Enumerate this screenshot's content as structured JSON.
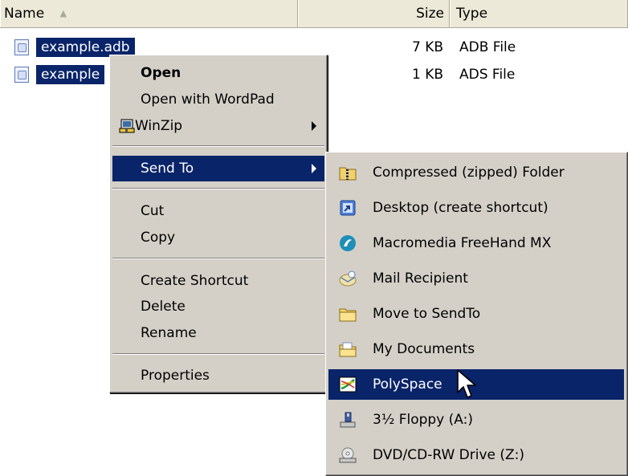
{
  "columns": {
    "name": "Name",
    "size": "Size",
    "type": "Type"
  },
  "files": [
    {
      "name": "example.adb",
      "size": "7 KB",
      "type": "ADB File"
    },
    {
      "name": "example",
      "size": "1 KB",
      "type": "ADS File"
    }
  ],
  "context_menu": {
    "open": "Open",
    "open_with": "Open with WordPad",
    "winzip": "WinZip",
    "send_to": "Send To",
    "cut": "Cut",
    "copy": "Copy",
    "create_shortcut": "Create Shortcut",
    "delete": "Delete",
    "rename": "Rename",
    "properties": "Properties"
  },
  "send_to_menu": {
    "compressed": "Compressed (zipped) Folder",
    "desktop": "Desktop (create shortcut)",
    "freehand": "Macromedia FreeHand MX",
    "mail": "Mail Recipient",
    "move": "Move to SendTo",
    "my_documents": "My Documents",
    "polyspace": "PolySpace",
    "floppy": "3½ Floppy (A:)",
    "dvd": "DVD/CD-RW Drive (Z:)"
  },
  "colors": {
    "selection": "#0a246a",
    "menu_bg": "#d4d0c8"
  }
}
